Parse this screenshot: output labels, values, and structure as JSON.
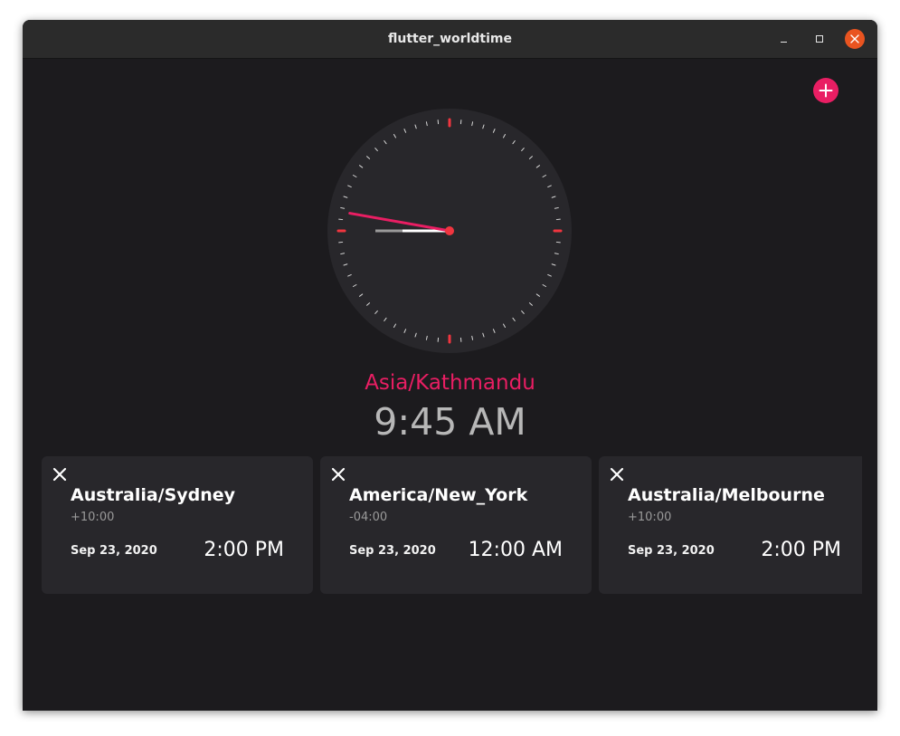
{
  "window": {
    "title": "flutter_worldtime"
  },
  "colors": {
    "accent": "#e91e63",
    "background": "#1c1b1e",
    "card": "#28272b",
    "clock_face": "#28272b",
    "close_button": "#e95420"
  },
  "icons": {
    "add": "plus-icon",
    "remove": "close-icon",
    "minimize": "minimize-icon",
    "maximize": "maximize-icon",
    "close": "close-icon"
  },
  "main_clock": {
    "zone": "Asia/Kathmandu",
    "time": "9:45 AM",
    "hour": 9,
    "minute": 45
  },
  "cards": [
    {
      "city": "Australia/Sydney",
      "offset": "+10:00",
      "date": "Sep 23, 2020",
      "time": "2:00 PM"
    },
    {
      "city": "America/New_York",
      "offset": "-04:00",
      "date": "Sep 23, 2020",
      "time": "12:00 AM"
    },
    {
      "city": "Australia/Melbourne",
      "offset": "+10:00",
      "date": "Sep 23, 2020",
      "time": "2:00 PM"
    }
  ]
}
